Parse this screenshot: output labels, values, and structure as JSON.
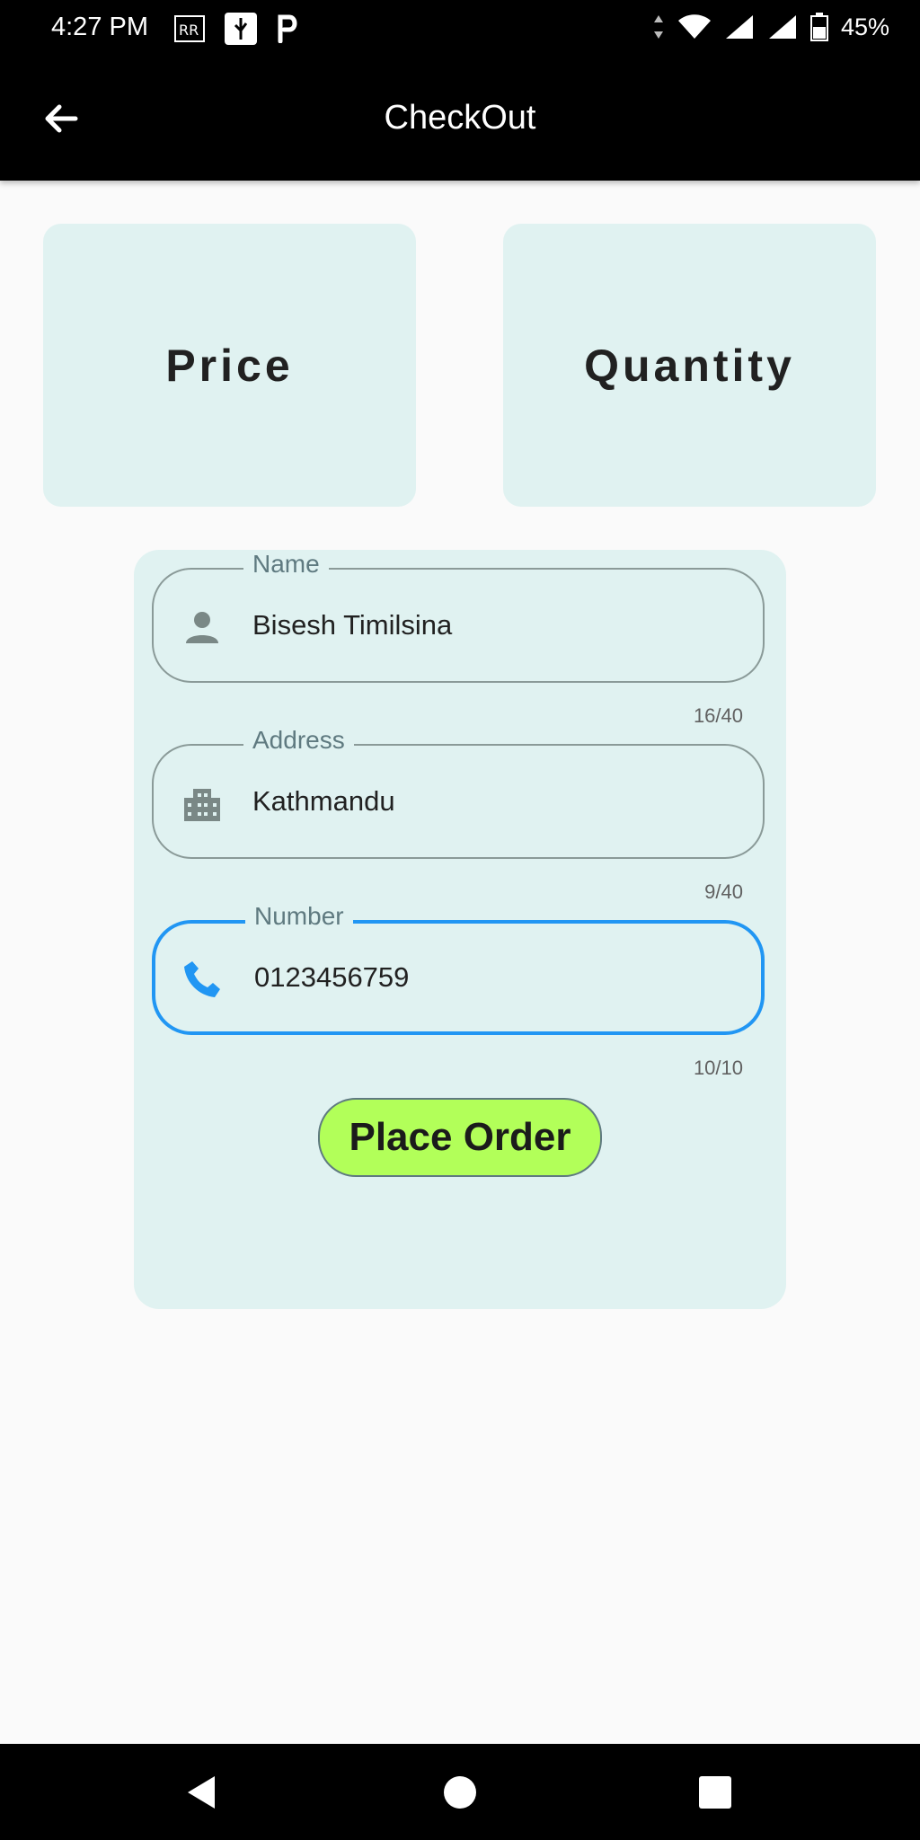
{
  "status_bar": {
    "time": "4:27 PM",
    "battery": "45%",
    "icons": [
      "rr-icon",
      "usb-icon",
      "parking-icon",
      "data-arrows-icon",
      "wifi-icon",
      "signal-icon",
      "signal-icon",
      "battery-icon"
    ]
  },
  "app_bar": {
    "title": "CheckOut",
    "back_icon": "arrow-back-icon"
  },
  "cards": {
    "price_label": "Price",
    "quantity_label": "Quantity"
  },
  "form": {
    "name": {
      "label": "Name",
      "value": "Bisesh Timilsina",
      "counter": "16/40",
      "icon": "person-icon"
    },
    "address": {
      "label": "Address",
      "value": "Kathmandu",
      "counter": "9/40",
      "icon": "building-icon"
    },
    "number": {
      "label": "Number",
      "value": "0123456759",
      "counter": "10/10",
      "icon": "phone-icon"
    },
    "submit_label": "Place Order"
  },
  "colors": {
    "accent": "#2196f3",
    "card_bg": "#e0f2f1",
    "button_bg": "#b2ff59"
  },
  "nav_bar": {
    "icons": [
      "back-triangle-icon",
      "home-circle-icon",
      "recents-square-icon"
    ]
  }
}
